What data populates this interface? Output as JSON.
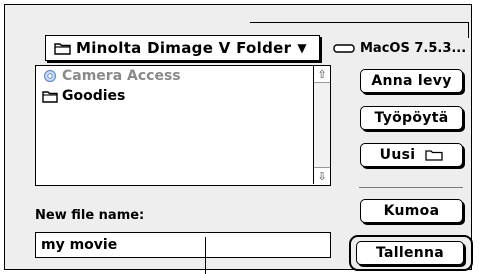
{
  "dialog": {
    "folder_popup": {
      "label": "Minolta Dimage V Folder"
    },
    "volume": {
      "label": "MacOS 7.5.3..."
    },
    "file_list": {
      "items": [
        {
          "name": "Camera Access",
          "icon": "alias-app-icon",
          "enabled": false
        },
        {
          "name": "Goodies",
          "icon": "folder-icon",
          "enabled": true
        }
      ]
    },
    "buttons": {
      "eject": "Anna levy",
      "desktop": "Työpöytä",
      "new_folder": "Uusi",
      "cancel": "Kumoa",
      "save": "Tallenna"
    },
    "name_field": {
      "label": "New file name:",
      "value": "my movie"
    }
  }
}
